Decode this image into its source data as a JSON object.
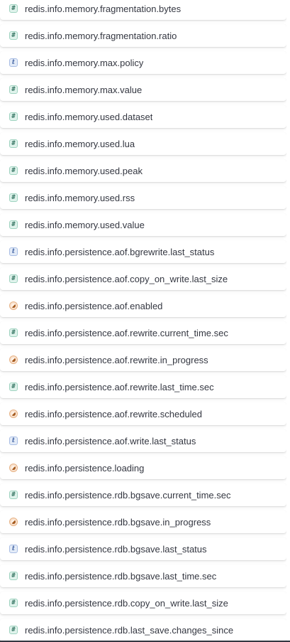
{
  "fields": [
    {
      "name": "redis.info.memory.fragmentation.bytes",
      "type": "number",
      "icon": "number-icon",
      "glyph": "#"
    },
    {
      "name": "redis.info.memory.fragmentation.ratio",
      "type": "number",
      "icon": "number-icon",
      "glyph": "#"
    },
    {
      "name": "redis.info.memory.max.policy",
      "type": "string",
      "icon": "string-icon",
      "glyph": "t"
    },
    {
      "name": "redis.info.memory.max.value",
      "type": "number",
      "icon": "number-icon",
      "glyph": "#"
    },
    {
      "name": "redis.info.memory.used.dataset",
      "type": "number",
      "icon": "number-icon",
      "glyph": "#"
    },
    {
      "name": "redis.info.memory.used.lua",
      "type": "number",
      "icon": "number-icon",
      "glyph": "#"
    },
    {
      "name": "redis.info.memory.used.peak",
      "type": "number",
      "icon": "number-icon",
      "glyph": "#"
    },
    {
      "name": "redis.info.memory.used.rss",
      "type": "number",
      "icon": "number-icon",
      "glyph": "#"
    },
    {
      "name": "redis.info.memory.used.value",
      "type": "number",
      "icon": "number-icon",
      "glyph": "#"
    },
    {
      "name": "redis.info.persistence.aof.bgrewrite.last_status",
      "type": "string",
      "icon": "string-icon",
      "glyph": "t"
    },
    {
      "name": "redis.info.persistence.aof.copy_on_write.last_size",
      "type": "number",
      "icon": "number-icon",
      "glyph": "#"
    },
    {
      "name": "redis.info.persistence.aof.enabled",
      "type": "boolean",
      "icon": "boolean-icon",
      "glyph": ""
    },
    {
      "name": "redis.info.persistence.aof.rewrite.current_time.sec",
      "type": "number",
      "icon": "number-icon",
      "glyph": "#"
    },
    {
      "name": "redis.info.persistence.aof.rewrite.in_progress",
      "type": "boolean",
      "icon": "boolean-icon",
      "glyph": ""
    },
    {
      "name": "redis.info.persistence.aof.rewrite.last_time.sec",
      "type": "number",
      "icon": "number-icon",
      "glyph": "#"
    },
    {
      "name": "redis.info.persistence.aof.rewrite.scheduled",
      "type": "boolean",
      "icon": "boolean-icon",
      "glyph": ""
    },
    {
      "name": "redis.info.persistence.aof.write.last_status",
      "type": "string",
      "icon": "string-icon",
      "glyph": "t"
    },
    {
      "name": "redis.info.persistence.loading",
      "type": "boolean",
      "icon": "boolean-icon",
      "glyph": ""
    },
    {
      "name": "redis.info.persistence.rdb.bgsave.current_time.sec",
      "type": "number",
      "icon": "number-icon",
      "glyph": "#"
    },
    {
      "name": "redis.info.persistence.rdb.bgsave.in_progress",
      "type": "boolean",
      "icon": "boolean-icon",
      "glyph": ""
    },
    {
      "name": "redis.info.persistence.rdb.bgsave.last_status",
      "type": "string",
      "icon": "string-icon",
      "glyph": "t"
    },
    {
      "name": "redis.info.persistence.rdb.bgsave.last_time.sec",
      "type": "number",
      "icon": "number-icon",
      "glyph": "#"
    },
    {
      "name": "redis.info.persistence.rdb.copy_on_write.last_size",
      "type": "number",
      "icon": "number-icon",
      "glyph": "#"
    },
    {
      "name": "redis.info.persistence.rdb.last_save.changes_since",
      "type": "number",
      "icon": "number-icon",
      "glyph": "#"
    }
  ],
  "colors": {
    "text": "#343741",
    "number_icon_bg": "#e0f3ec",
    "string_icon_bg": "#e4ecf8",
    "boolean_icon_bg": "#f9e2cf"
  }
}
